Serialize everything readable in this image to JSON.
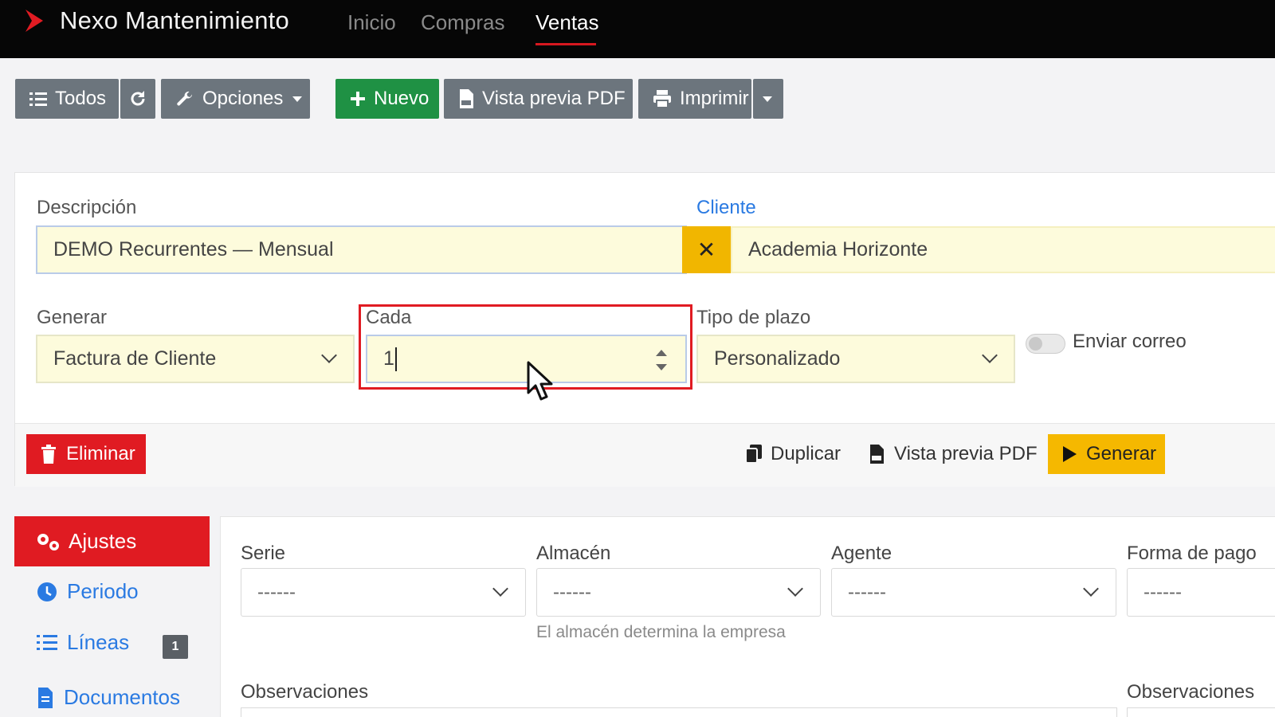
{
  "navbar": {
    "brand": "Nexo Mantenimiento",
    "items": [
      {
        "label": "Inicio",
        "active": false
      },
      {
        "label": "Compras",
        "active": false
      },
      {
        "label": "Ventas",
        "active": true
      }
    ]
  },
  "toolbar": {
    "all_label": "Todos",
    "options_label": "Opciones",
    "new_label": "Nuevo",
    "pdf_preview_label": "Vista previa PDF",
    "print_label": "Imprimir"
  },
  "form": {
    "description": {
      "label": "Descripción",
      "value": "DEMO Recurrentes — Mensual"
    },
    "client": {
      "label": "Cliente",
      "value": "Academia Horizonte",
      "clear_label": "✕"
    },
    "generate": {
      "label": "Generar",
      "value": "Factura de Cliente"
    },
    "every": {
      "label": "Cada",
      "value": "1"
    },
    "term_type": {
      "label": "Tipo de plazo",
      "value": "Personalizado"
    },
    "send_email": {
      "label": "Enviar correo",
      "enabled": false
    }
  },
  "actions": {
    "delete_label": "Eliminar",
    "duplicate_label": "Duplicar",
    "pdf_preview_label": "Vista previa PDF",
    "generate_label": "Generar"
  },
  "sidebar": {
    "items": [
      {
        "label": "Ajustes",
        "active": true
      },
      {
        "label": "Periodo",
        "active": false
      },
      {
        "label": "Líneas",
        "active": false,
        "badge": "1"
      },
      {
        "label": "Documentos",
        "active": false
      }
    ]
  },
  "settings": {
    "serie": {
      "label": "Serie",
      "value": "------"
    },
    "warehouse": {
      "label": "Almacén",
      "value": "------",
      "help": "El almacén determina la empresa"
    },
    "agent": {
      "label": "Agente",
      "value": "------"
    },
    "payment": {
      "label": "Forma de pago",
      "value": "------"
    },
    "observations_label": "Observaciones",
    "observations2_label": "Observaciones"
  },
  "colors": {
    "brand_red": "#e01b22",
    "navbar_bg": "#060606",
    "success_green": "#1f9144",
    "warning_yellow": "#f5b800",
    "link_blue": "#2a7ae2",
    "field_yellow": "#fdfbdc"
  }
}
